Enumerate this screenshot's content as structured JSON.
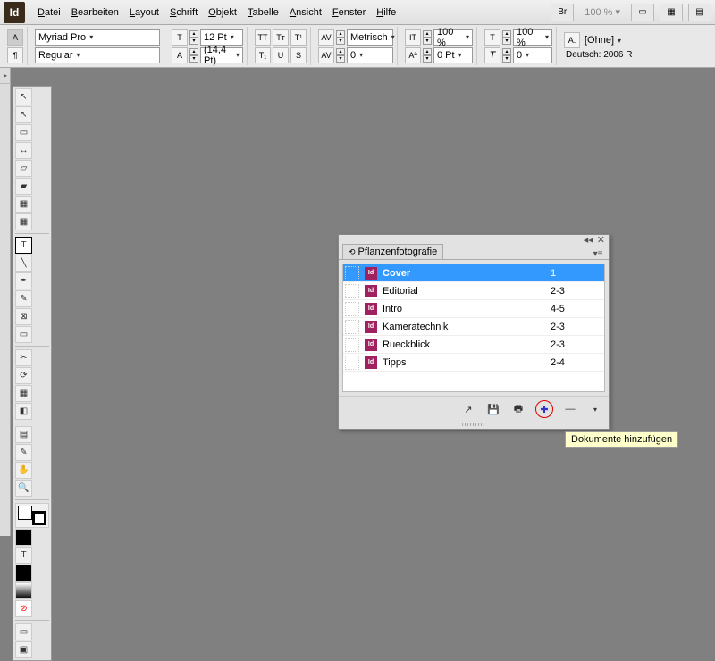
{
  "menubar": {
    "items": [
      "Datei",
      "Bearbeiten",
      "Layout",
      "Schrift",
      "Objekt",
      "Tabelle",
      "Ansicht",
      "Fenster",
      "Hilfe"
    ],
    "br_label": "Br",
    "zoom": "100 %"
  },
  "controlbar": {
    "font_family": "Myriad Pro",
    "font_style": "Regular",
    "font_size": "12 Pt",
    "leading": "(14,4 Pt)",
    "kerning_mode": "Metrisch",
    "tracking": "0",
    "hscale": "100 %",
    "vscale": "100 %",
    "baseline": "0 Pt",
    "skew": "0",
    "charstyle": "[Ohne]",
    "lang": "Deutsch: 2006 R"
  },
  "panel": {
    "tab_title": "Pflanzenfotografie",
    "rows": [
      {
        "name": "Cover",
        "pages": "1",
        "selected": true
      },
      {
        "name": "Editorial",
        "pages": "2-3",
        "selected": false
      },
      {
        "name": "Intro",
        "pages": "4-5",
        "selected": false
      },
      {
        "name": "Kameratechnik",
        "pages": "2-3",
        "selected": false
      },
      {
        "name": "Rueckblick",
        "pages": "2-3",
        "selected": false
      },
      {
        "name": "Tipps",
        "pages": "2-4",
        "selected": false
      }
    ]
  },
  "tooltip": "Dokumente hinzufügen"
}
